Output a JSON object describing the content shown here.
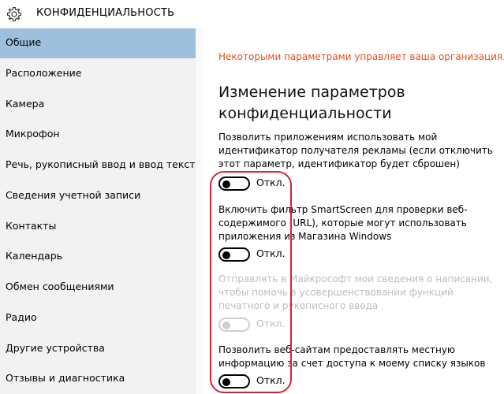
{
  "header": {
    "title": "КОНФИДЕНЦИАЛЬНОСТЬ",
    "icon": "gear-icon"
  },
  "sidebar": {
    "selected_index": 0,
    "items": [
      {
        "label": "Общие"
      },
      {
        "label": "Расположение"
      },
      {
        "label": "Камера"
      },
      {
        "label": "Микрофон"
      },
      {
        "label": "Речь, рукописный ввод и ввод текста"
      },
      {
        "label": "Сведения учетной записи"
      },
      {
        "label": "Контакты"
      },
      {
        "label": "Календарь"
      },
      {
        "label": "Обмен сообщениями"
      },
      {
        "label": "Радио"
      },
      {
        "label": "Другие устройства"
      },
      {
        "label": "Отзывы и диагностика"
      }
    ]
  },
  "main": {
    "org_note": "Некоторыми параметрами управляет ваша организация.",
    "section_title": "Изменение параметров конфиденциальности",
    "settings": [
      {
        "description": "Позволить приложениям использовать мой идентификатор получателя рекламы (если отключить этот параметр, идентификатор будет сброшен)",
        "state": "Откл.",
        "on": false,
        "enabled": true
      },
      {
        "description": "Включить фильтр SmartScreen для проверки веб-содержимого (URL), которые могут использовать приложения из Магазина Windows",
        "state": "Откл.",
        "on": false,
        "enabled": true
      },
      {
        "description": "Отправлять в Майкрософт мои сведения о написании, чтобы помочь в усовершенствовании функций печатного и рукописного ввода",
        "state": "Откл.",
        "on": false,
        "enabled": false
      },
      {
        "description": "Позволить веб-сайтам предоставлять местную информацию за счет доступа к моему списку языков",
        "state": "Откл.",
        "on": false,
        "enabled": true
      }
    ]
  },
  "colors": {
    "accent_selected": "#9ec0dc",
    "org_note": "#e1501e",
    "highlight": "#d9232e"
  }
}
